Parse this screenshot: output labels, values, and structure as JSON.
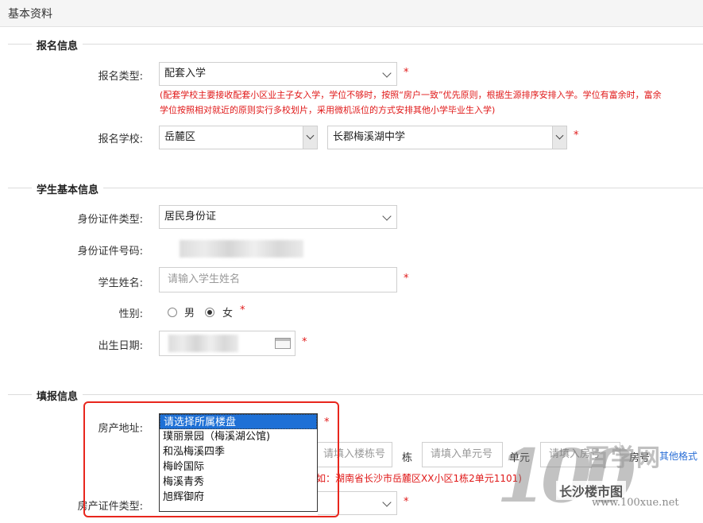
{
  "header": {
    "title": "基本资料"
  },
  "sections": {
    "register": "报名信息",
    "student": "学生基本信息",
    "fill": "填报信息"
  },
  "register": {
    "type_label": "报名类型:",
    "type_value": "配套入学",
    "note": "(配套学校主要接收配套小区业主子女入学，学位不够时，按照“房户一致”优先原则，根据生源排序安排入学。学位有富余时，富余学位按照相对就近的原则实行多校划片，采用微机派位的方式安排其他小学毕业生入学)",
    "school_label": "报名学校:",
    "district_value": "岳麓区",
    "school_value": "长郡梅溪湖中学"
  },
  "student": {
    "id_type_label": "身份证件类型:",
    "id_type_value": "居民身份证",
    "id_no_label": "身份证件号码:",
    "name_label": "学生姓名:",
    "name_placeholder": "请输入学生姓名",
    "gender_label": "性别:",
    "gender_male": "男",
    "gender_female": "女",
    "gender_selected": "女",
    "birth_label": "出生日期:"
  },
  "fill": {
    "address_label": "房产地址:",
    "estate_options": [
      "请选择所属楼盘",
      "璞丽景园（梅溪湖公馆)",
      "和泓梅溪四季",
      "梅岭国际",
      "梅溪青秀",
      "旭辉御府"
    ],
    "estate_selected_index": 0,
    "building_placeholder": "请填入楼栋号",
    "building_unit": "栋",
    "unit_placeholder": "请填入单元号",
    "unit_unit": "单元",
    "room_placeholder": "请填入房号",
    "room_unit": "房号",
    "other_format_link": "其他格式",
    "example_hint": "如：湖南省长沙市岳麓区XX小区1栋2单元1101)",
    "cert_type_label": "房产证件类型:"
  },
  "required_mark": "*",
  "watermark": {
    "number": "100",
    "name": "百学网",
    "tag": "长沙楼市图",
    "site": "www.100xue.net"
  }
}
